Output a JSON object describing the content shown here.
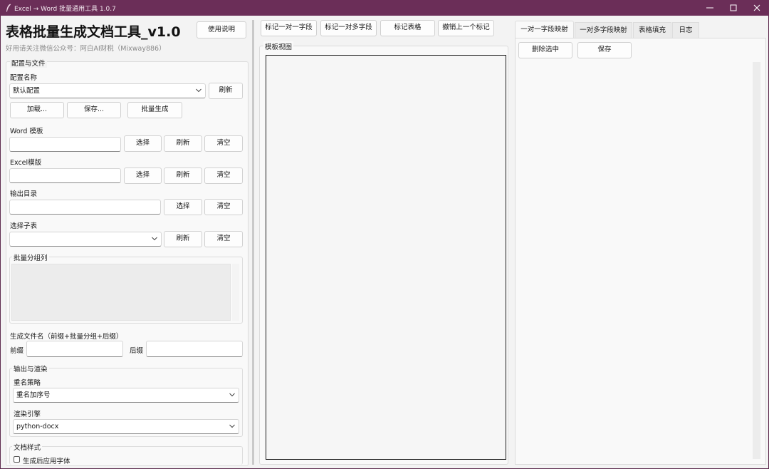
{
  "window": {
    "title": "Excel → Word 批量通用工具 1.0.7",
    "frame_color": "#6b2e58"
  },
  "left": {
    "app_title": "表格批量生成文档工具_v1.0",
    "subtitle": "好用请关注微信公众号：阿白AI财税（Mixway886）",
    "help_button": "使用说明",
    "config_section": "配置与文件",
    "config_name_label": "配置名称",
    "config_value": "默认配置",
    "refresh": "刷新",
    "load": "加载...",
    "save": "保存...",
    "batch_generate": "批量生成",
    "word_template_label": "Word 模板",
    "excel_template_label": "Excel模版",
    "output_dir_label": "输出目录",
    "sheet_label": "选择子表",
    "select": "选择",
    "clear": "清空",
    "word_template_value": "",
    "excel_template_value": "",
    "output_dir_value": "",
    "sheet_value": "",
    "group_col_title": "批量分组列",
    "filename_label": "生成文件名（前缀+批量分组+后缀）",
    "prefix_label": "前缀",
    "suffix_label": "后缀",
    "prefix_value": "",
    "suffix_value": "",
    "output_render_title": "输出与渲染",
    "rename_label": "重名策略",
    "rename_value": "重名加序号",
    "engine_label": "渲染引擎",
    "engine_value": "python-docx",
    "doc_style_title": "文档样式",
    "apply_font_label": "生成后应用字体",
    "apply_font_checked": false
  },
  "middle": {
    "mark_one_to_one": "标记一对一字段",
    "mark_one_to_many": "标记一对多字段",
    "mark_table": "标记表格",
    "undo_mark": "撤销上一个标记",
    "template_view_title": "模板视图"
  },
  "right": {
    "tabs": [
      "一对一字段映射",
      "一对多字段映射",
      "表格填充",
      "日志"
    ],
    "active_tab": 0,
    "delete_selected": "删除选中",
    "save": "保存"
  }
}
